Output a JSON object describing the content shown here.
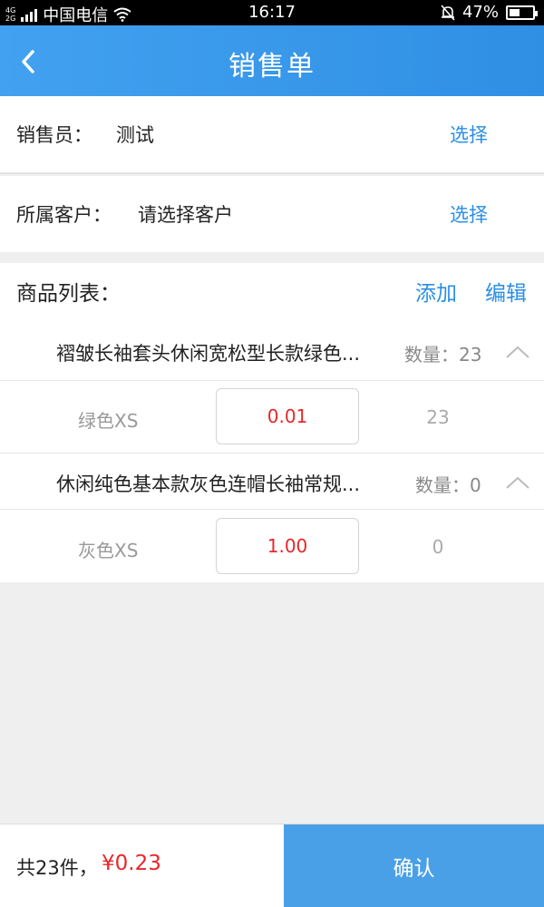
{
  "status_bar": {
    "net_type_top": "4G",
    "net_type_bottom": "2G",
    "carrier": "中国电信",
    "time": "16:17",
    "battery": "47%",
    "battery_level": 0.47
  },
  "header": {
    "title": "销售单",
    "back_icon": "chevron-left-icon"
  },
  "salesperson": {
    "label": "销售员：",
    "value": "测试",
    "select_label": "选择"
  },
  "customer": {
    "label": "所属客户：",
    "value": "请选择客户",
    "select_label": "选择"
  },
  "products": {
    "title": "商品列表：",
    "add_label": "添加",
    "edit_label": "编辑",
    "items": [
      {
        "name": "褶皱长袖套头休闲宽松型长款绿色...",
        "qty_label": "数量：23",
        "variant": {
          "name": "绿色XS",
          "price": "0.01",
          "qty": "23"
        }
      },
      {
        "name": "休闲纯色基本款灰色连帽长袖常规...",
        "qty_label": "数量：0",
        "variant": {
          "name": "灰色XS",
          "price": "1.00",
          "qty": "0"
        }
      }
    ]
  },
  "footer": {
    "count": "共23件，",
    "total": "¥0.23",
    "confirm_label": "确认"
  },
  "colors": {
    "accent": "#2a8ee6",
    "header": "#3a9bec",
    "price": "#e8262a",
    "confirm": "#4aa0e6"
  }
}
